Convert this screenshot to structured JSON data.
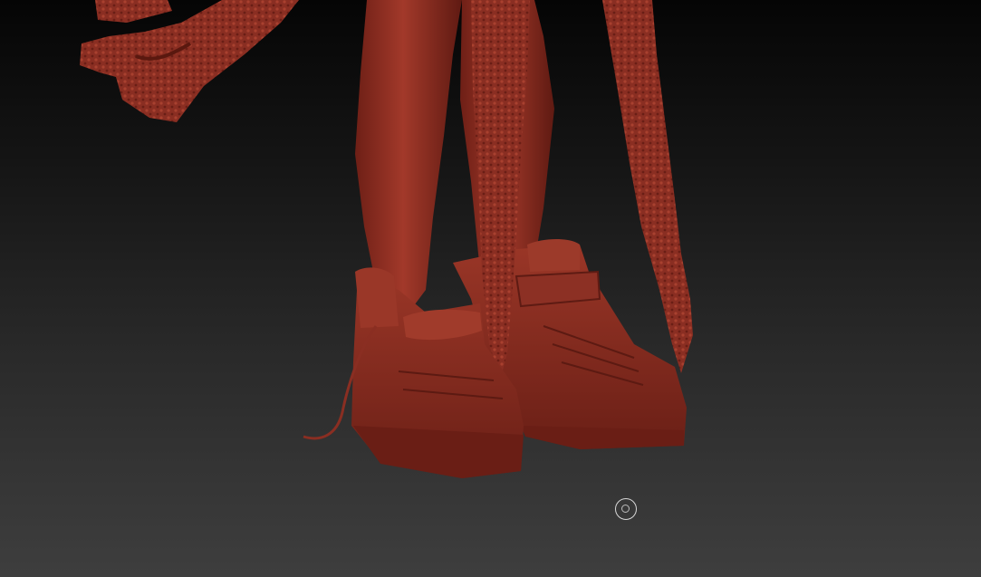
{
  "viewport": {
    "background_top": "#050505",
    "background_bottom": "#3e3e3e",
    "material_color": "#8e2e22"
  },
  "model": {
    "parts": [
      "tentacle-left",
      "leg-left",
      "leg-right",
      "tail-center",
      "tail-right",
      "sneaker-left",
      "sneaker-right",
      "shoelace"
    ]
  },
  "cursor": {
    "icon": "brush-cursor-icon"
  }
}
